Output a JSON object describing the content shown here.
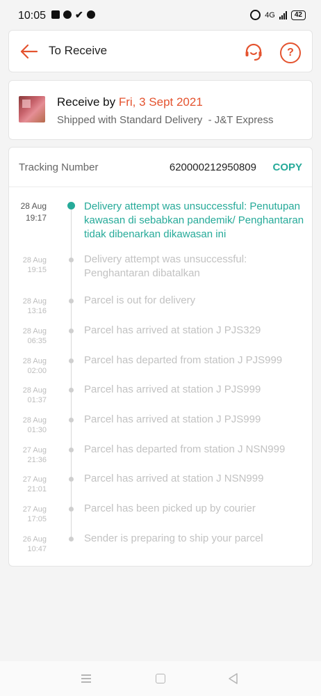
{
  "status_bar": {
    "time": "10:05",
    "network": "4G",
    "battery": "42"
  },
  "header": {
    "title": "To Receive",
    "back_icon": "arrow-left-icon",
    "support_icon": "headset-icon",
    "help_icon": "?"
  },
  "receive": {
    "prefix": "Receive by ",
    "date": "Fri, 3 Sept 2021",
    "shipping": "Shipped with Standard Delivery  - J&T Express"
  },
  "tracking": {
    "label": "Tracking Number",
    "number": "620000212950809",
    "copy_label": "COPY",
    "events": [
      {
        "date": "28 Aug",
        "time": "19:17",
        "desc": "Delivery attempt was unsuccessful: Penutupan kawasan di sebabkan pandemik/ Penghantaran tidak dibenarkan dikawasan ini",
        "active": true
      },
      {
        "date": "28 Aug",
        "time": "19:15",
        "desc": "Delivery attempt was unsuccessful: Penghantaran dibatalkan",
        "active": false
      },
      {
        "date": "28 Aug",
        "time": "13:16",
        "desc": "Parcel is out for delivery",
        "active": false
      },
      {
        "date": "28 Aug",
        "time": "06:35",
        "desc": "Parcel has arrived at station J PJS329",
        "active": false
      },
      {
        "date": "28 Aug",
        "time": "02:00",
        "desc": "Parcel has departed from station J PJS999",
        "active": false
      },
      {
        "date": "28 Aug",
        "time": "01:37",
        "desc": "Parcel has arrived at station J PJS999",
        "active": false
      },
      {
        "date": "28 Aug",
        "time": "01:30",
        "desc": "Parcel has arrived at station J PJS999",
        "active": false
      },
      {
        "date": "27 Aug",
        "time": "21:36",
        "desc": "Parcel has departed from station J NSN999",
        "active": false
      },
      {
        "date": "27 Aug",
        "time": "21:01",
        "desc": "Parcel has arrived at station J NSN999",
        "active": false
      },
      {
        "date": "27 Aug",
        "time": "17:05",
        "desc": "Parcel has been picked up by courier",
        "active": false
      },
      {
        "date": "26 Aug",
        "time": "10:47",
        "desc": "Sender is preparing to ship your parcel",
        "active": false
      }
    ]
  },
  "colors": {
    "accent": "#e4532f",
    "success": "#26aa99"
  }
}
